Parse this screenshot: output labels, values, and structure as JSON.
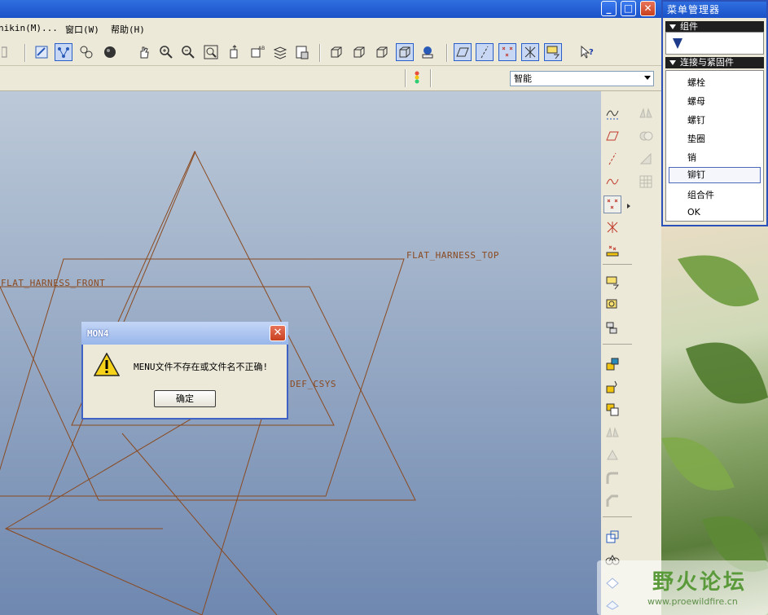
{
  "window": {
    "minimize_glyph": "_",
    "maximize_glyph": "□",
    "close_glyph": "✕"
  },
  "menubar": {
    "items": [
      "nikin(M)...",
      "窗口(W)",
      "帮助(H)"
    ]
  },
  "toolbar": {
    "icons": [
      "redraw-icon",
      "spin-center-icon",
      "orient-icon",
      "shading-icon",
      "pan-icon",
      "zoom-in-icon",
      "zoom-out-icon",
      "refit-icon",
      "reorient-icon",
      "saved-views-icon",
      "layers-icon",
      "model-tree-icon",
      "wireframe-icon",
      "hidden-line-icon",
      "no-hidden-icon",
      "shaded-icon",
      "display-style-icon",
      "datum-planes-icon",
      "datum-axes-icon",
      "datum-points-icon",
      "csys-icon",
      "annotation-icon",
      "context-help-icon"
    ]
  },
  "filterbar": {
    "selection_filter": "智能"
  },
  "viewport": {
    "datum_labels": {
      "top": "FLAT_HARNESS_TOP",
      "front": "FLAT_HARNESS_FRONT",
      "csys": "DEF_CSYS"
    }
  },
  "dialog": {
    "title": "MON4",
    "message": "MENU文件不存在或文件名不正确!",
    "ok_label": "确定"
  },
  "menu_manager": {
    "title": "菜单管理器",
    "section_assembly": "组件",
    "section_fasteners": "连接与紧固件",
    "items": [
      "螺栓",
      "螺母",
      "螺钉",
      "垫圈",
      "销",
      "铆钉",
      "组合件",
      "OK"
    ],
    "selected_index": 5
  },
  "watermark": {
    "title": "野火论坛",
    "url": "www.proewildfire.cn"
  },
  "colors": {
    "title_bar": "#1b52c8",
    "datum_plane": "#8a4a20",
    "viewport_top": "#bcc9d8",
    "viewport_bottom": "#6f88b0",
    "dialog_border": "#3e63c4"
  }
}
